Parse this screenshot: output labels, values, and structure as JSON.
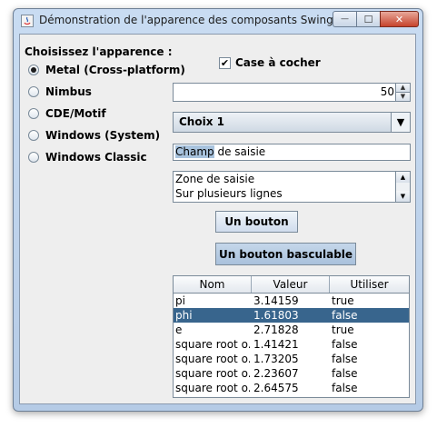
{
  "window": {
    "title": "Démonstration de l'apparence des composants Swing",
    "buttons": {
      "minimize": "—",
      "maximize": "☐",
      "close": "✕"
    }
  },
  "laf": {
    "heading": "Choisissez l'apparence :",
    "options": [
      {
        "label": "Metal (Cross-platform)",
        "selected": true
      },
      {
        "label": "Nimbus",
        "selected": false
      },
      {
        "label": "CDE/Motif",
        "selected": false
      },
      {
        "label": "Windows (System)",
        "selected": false
      },
      {
        "label": "Windows Classic",
        "selected": false
      }
    ]
  },
  "checkbox": {
    "label": "Case à cocher",
    "checked": true,
    "mark": "✔"
  },
  "spinner": {
    "value": "50"
  },
  "combo": {
    "selected": "Choix 1"
  },
  "textfield": {
    "selected_part": "Champ",
    "rest": " de saisie"
  },
  "textarea": {
    "lines": [
      "Zone de saisie",
      "Sur plusieurs lignes"
    ]
  },
  "buttons": {
    "button": "Un bouton",
    "toggle": "Un bouton basculable"
  },
  "table": {
    "headers": [
      "Nom",
      "Valeur",
      "Utiliser"
    ],
    "rows": [
      [
        "pi",
        "3.14159",
        "true"
      ],
      [
        "phi",
        "1.61803",
        "false"
      ],
      [
        "e",
        "2.71828",
        "true"
      ],
      [
        "square root o...",
        "1.41421",
        "false"
      ],
      [
        "square root o...",
        "1.73205",
        "false"
      ],
      [
        "square root o...",
        "2.23607",
        "false"
      ],
      [
        "square root o...",
        "2.64575",
        "false"
      ]
    ],
    "selected_row": 1
  },
  "colors": {
    "selection": "#38658d",
    "text_selection": "#a8c3de",
    "toggle_pressed": "#b4c9e0"
  }
}
